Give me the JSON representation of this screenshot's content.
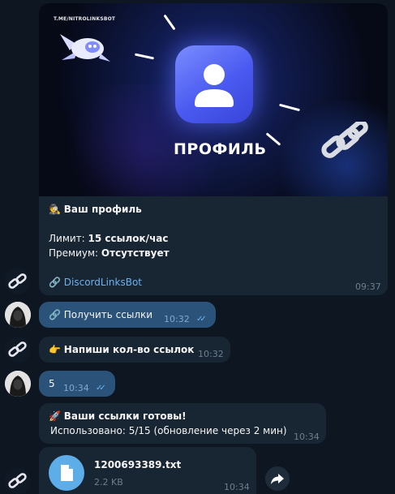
{
  "banner": {
    "watermark": "T.ME/NITROLINKSBOT",
    "title": "ПРОФИЛЬ"
  },
  "profile_message": {
    "emoji": "🕵",
    "heading": "Ваш профиль",
    "limit_label": "Лимит:",
    "limit_value": "15 ссылок/час",
    "premium_label": "Премиум:",
    "premium_value": "Отсутствует",
    "link_emoji": "🔗",
    "link_text": "DiscordLinksBot",
    "time": "09:37"
  },
  "messages": [
    {
      "emoji": "🔗",
      "text": "Получить ссылки",
      "time": "10:32",
      "outgoing": true
    },
    {
      "emoji": "👉",
      "text": "Напиши кол-во ссылок",
      "time": "10:32",
      "outgoing": false
    },
    {
      "emoji": "",
      "text": "5",
      "time": "10:34",
      "outgoing": true
    }
  ],
  "ready_message": {
    "emoji": "🚀",
    "heading": "Ваши ссылки готовы!",
    "usage": "Использовано: 5/15 (обновление через 2 мин)",
    "time": "10:34"
  },
  "file_message": {
    "filename": "1200693389.txt",
    "size": "2.2 KB",
    "time": "10:34",
    "icon": "file-icon"
  },
  "colors": {
    "background": "#0e1621",
    "incoming_bubble": "#182533",
    "outgoing_bubble": "#2b5278",
    "link": "#6ab2f2"
  }
}
